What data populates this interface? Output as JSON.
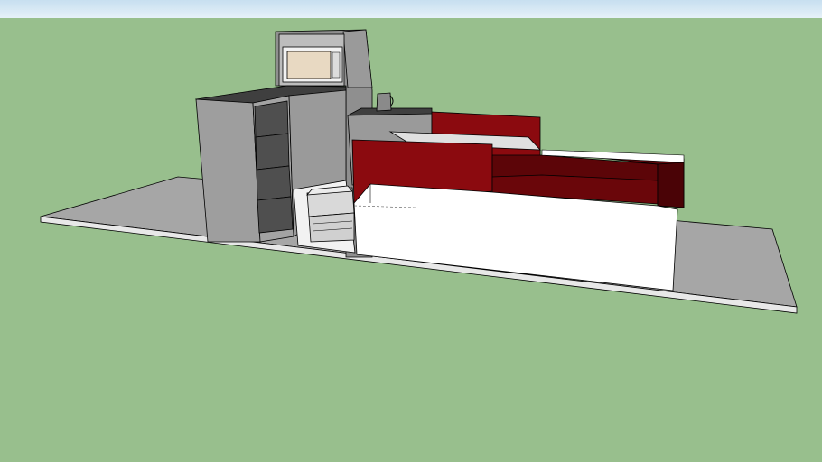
{
  "scene": {
    "kind": "3d-model-viewport",
    "colors": {
      "sky_top": "#c7dff0",
      "sky_bottom": "#e6f1f8",
      "ground": "#98bf8d",
      "floor_slab": "#a6a6a6",
      "floor_edge": "#e8e8e8",
      "cabinet_gray": "#9e9e9e",
      "cabinet_dark": "#5a5a5a",
      "counter_red": "#8b0a0f",
      "counter_dark_red": "#5c0508",
      "panel_white": "#ffffff",
      "outline": "#000000"
    },
    "objects": [
      {
        "id": "floor-slab",
        "icon": "floor-slab"
      },
      {
        "id": "drawer-cabinet",
        "icon": "cabinet",
        "drawer_count": 4
      },
      {
        "id": "tall-cabinet",
        "icon": "cabinet"
      },
      {
        "id": "microwave",
        "icon": "microwave"
      },
      {
        "id": "kettle",
        "icon": "kettle"
      },
      {
        "id": "printer",
        "icon": "printer"
      },
      {
        "id": "red-counter-back",
        "icon": "counter"
      },
      {
        "id": "red-counter-front",
        "icon": "counter"
      },
      {
        "id": "white-panel",
        "icon": "panel"
      }
    ]
  }
}
